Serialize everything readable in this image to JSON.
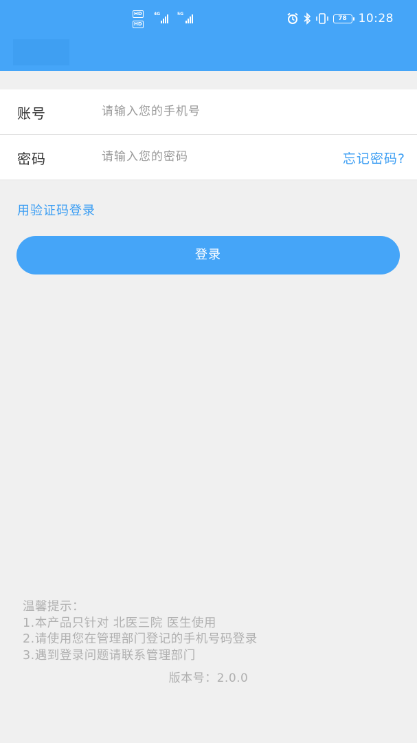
{
  "status_bar": {
    "hd_label": "HD",
    "net_4g": "4G",
    "net_5g": "5G",
    "battery": "78",
    "time": "10:28"
  },
  "form": {
    "account_label": "账号",
    "account_placeholder": "请输入您的手机号",
    "password_label": "密码",
    "password_placeholder": "请输入您的密码",
    "forgot_link": "忘记密码?"
  },
  "sms_login_link": "用验证码登录",
  "login_button": "登录",
  "tips": {
    "title": "温馨提示：",
    "lines": [
      "1.本产品只针对 北医三院 医生使用",
      "2.请使用您在管理部门登记的手机号码登录",
      "3.遇到登录问题请联系管理部门"
    ]
  },
  "version": "版本号：2.0.0",
  "colors": {
    "primary": "#45a5f8",
    "link": "#3c9ef3",
    "background": "#f0f0f0",
    "hint_text": "#b0b0b0"
  }
}
